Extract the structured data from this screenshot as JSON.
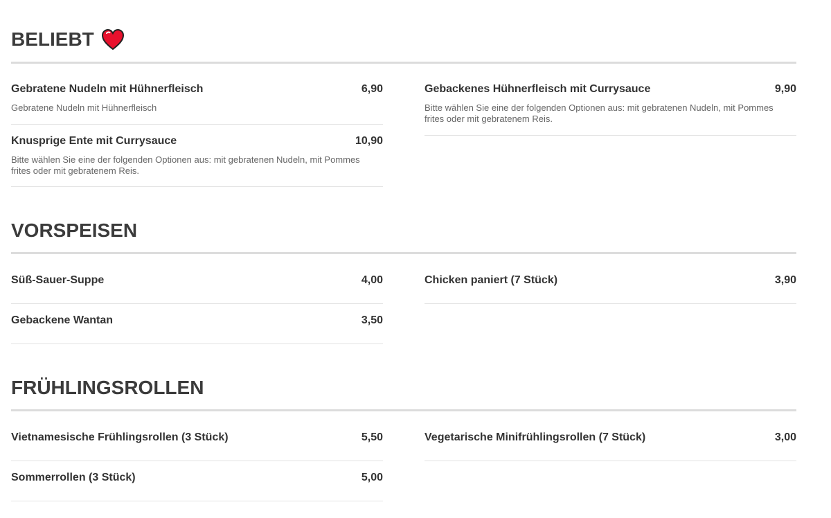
{
  "sections": [
    {
      "title": "BELIEBT",
      "items": [
        {
          "name": "Gebratene Nudeln mit Hühnerfleisch",
          "price": "6,90",
          "desc": "Gebratene Nudeln mit Hühnerfleisch"
        },
        {
          "name": "Gebackenes Hühnerfleisch mit Currysauce",
          "price": "9,90",
          "desc": "Bitte wählen Sie eine der folgenden Optionen aus: mit gebratenen Nudeln, mit Pommes frites oder mit gebratenem Reis."
        },
        {
          "name": "Knusprige Ente mit Currysauce",
          "price": "10,90",
          "desc": "Bitte wählen Sie eine der folgenden Optionen aus: mit gebratenen Nudeln, mit Pommes frites oder mit gebratenem Reis."
        }
      ]
    },
    {
      "title": "VORSPEISEN",
      "items": [
        {
          "name": "Süß-Sauer-Suppe",
          "price": "4,00"
        },
        {
          "name": "Chicken paniert (7 Stück)",
          "price": "3,90"
        },
        {
          "name": "Gebackene Wantan",
          "price": "3,50"
        }
      ]
    },
    {
      "title": "FRÜHLINGSROLLEN",
      "items": [
        {
          "name": "Vietnamesische Frühlingsrollen (3 Stück)",
          "price": "5,50"
        },
        {
          "name": "Vegetarische Minifrühlingsrollen (7 Stück)",
          "price": "3,00"
        },
        {
          "name": "Sommerrollen (3 Stück)",
          "price": "5,00"
        }
      ]
    }
  ],
  "icons": {
    "favorite": "heart-icon"
  },
  "colors": {
    "heart": "#e8112d",
    "heading": "#3b3b3b",
    "rule": "#dcdcdc"
  }
}
